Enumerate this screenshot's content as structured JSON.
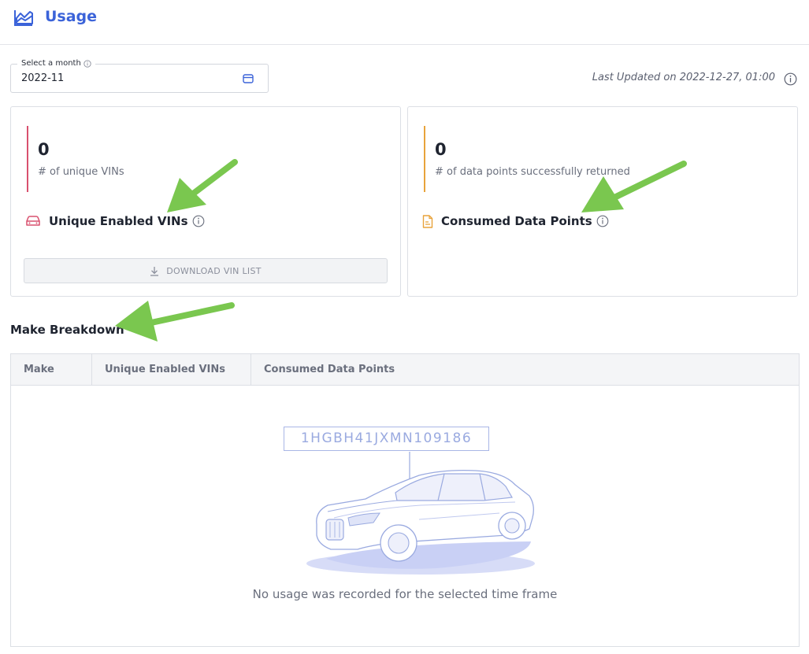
{
  "header": {
    "title": "Usage",
    "icon": "chart-line-icon",
    "color": "#3b63d9"
  },
  "month_picker": {
    "label": "Select a month",
    "value": "2022-11"
  },
  "last_updated": "Last Updated on 2022-12-27, 01:00",
  "cards": {
    "vins": {
      "count": "0",
      "caption": "# of unique VINs",
      "label": "Unique Enabled VINs",
      "accent": "#d9506e",
      "download_label": "DOWNLOAD VIN LIST"
    },
    "data_points": {
      "count": "0",
      "caption": "# of data points successfully returned",
      "label": "Consumed Data Points",
      "accent": "#e8a33b"
    }
  },
  "breakdown": {
    "title": "Make Breakdown",
    "columns": [
      "Make",
      "Unique Enabled VINs",
      "Consumed Data Points"
    ],
    "empty": {
      "vin": "1HGBH41JXMN109186",
      "message": "No usage was recorded for the selected time frame"
    }
  },
  "annotations": {
    "arrow_color": "#7ac74f"
  }
}
